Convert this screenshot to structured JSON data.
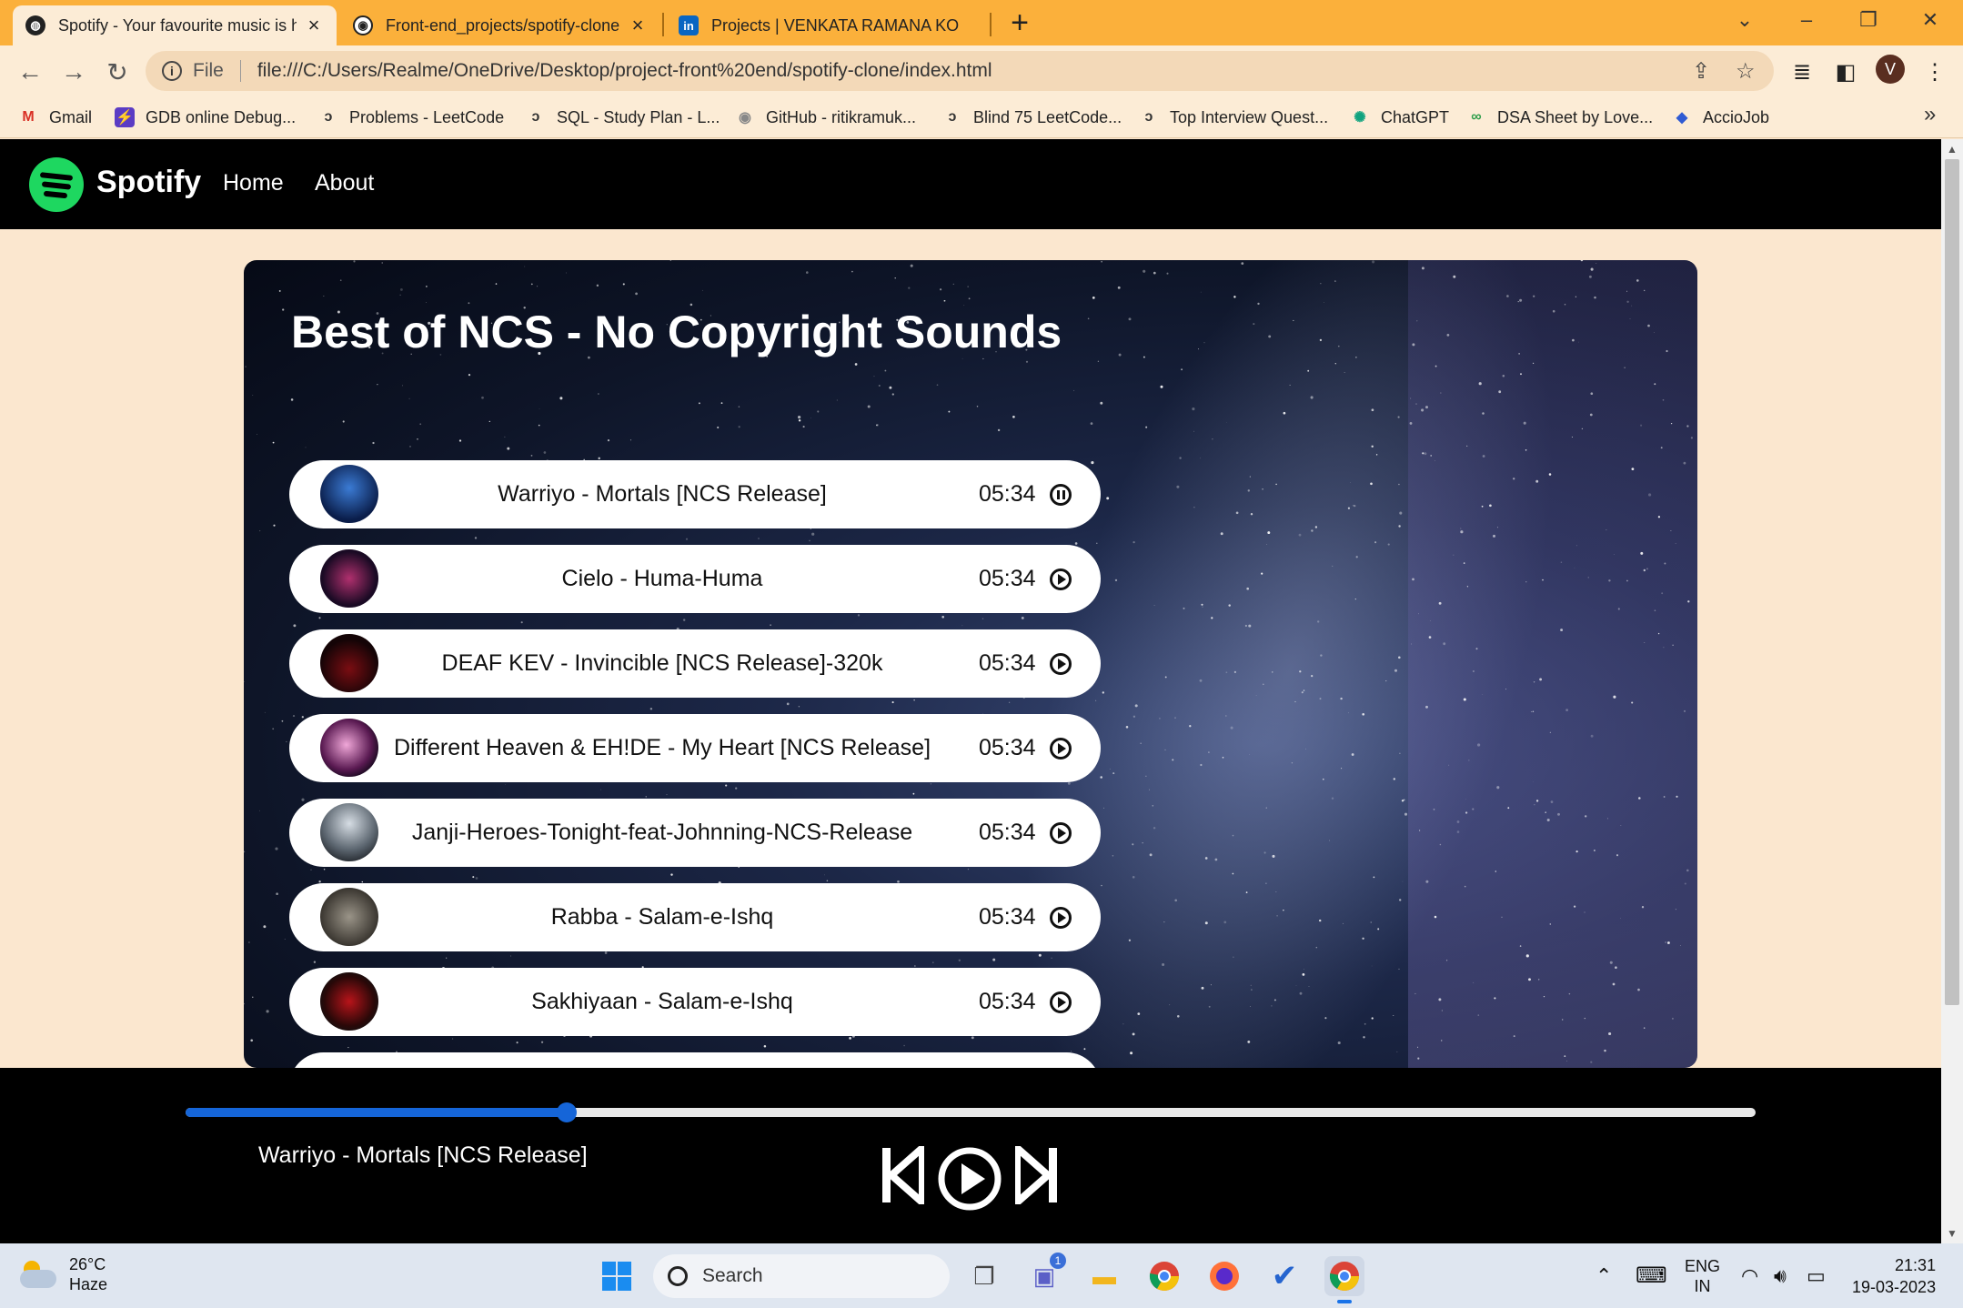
{
  "browser": {
    "tabs": [
      {
        "title": "Spotify - Your favourite music is h",
        "active": true
      },
      {
        "title": "Front-end_projects/spotify-clone",
        "active": false
      },
      {
        "title": "Projects | VENKATA RAMANA KO",
        "active": false
      }
    ],
    "address": {
      "scheme_label": "File",
      "url": "file:///C:/Users/Realme/OneDrive/Desktop/project-front%20end/spotify-clone/index.html"
    },
    "profile_initial": "V",
    "bookmarks": [
      {
        "label": "Gmail",
        "icon": "gmail-icon"
      },
      {
        "label": "GDB online Debug...",
        "icon": "gdb-icon"
      },
      {
        "label": "Problems - LeetCode",
        "icon": "leetcode-icon"
      },
      {
        "label": "SQL - Study Plan - L...",
        "icon": "leetcode-icon"
      },
      {
        "label": "GitHub - ritikramuk...",
        "icon": "github-icon"
      },
      {
        "label": "Blind 75 LeetCode...",
        "icon": "leetcode-icon"
      },
      {
        "label": "Top Interview Quest...",
        "icon": "leetcode-icon"
      },
      {
        "label": "ChatGPT",
        "icon": "chatgpt-icon"
      },
      {
        "label": "DSA Sheet by Love...",
        "icon": "dsa-icon"
      },
      {
        "label": "AccioJob",
        "icon": "acciojob-icon"
      }
    ]
  },
  "page": {
    "brand": "Spotify",
    "nav": [
      "Home",
      "About"
    ],
    "heading": "Best of NCS - No Copyright Sounds",
    "songs": [
      {
        "name": "Warriyo - Mortals [NCS Release]",
        "duration": "05:34",
        "state": "pause"
      },
      {
        "name": "Cielo - Huma-Huma",
        "duration": "05:34",
        "state": "play"
      },
      {
        "name": "DEAF KEV - Invincible [NCS Release]-320k",
        "duration": "05:34",
        "state": "play"
      },
      {
        "name": "Different Heaven & EH!DE - My Heart [NCS Release]",
        "duration": "05:34",
        "state": "play"
      },
      {
        "name": "Janji-Heroes-Tonight-feat-Johnning-NCS-Release",
        "duration": "05:34",
        "state": "play"
      },
      {
        "name": "Rabba - Salam-e-Ishq",
        "duration": "05:34",
        "state": "play"
      },
      {
        "name": "Sakhiyaan - Salam-e-Ishq",
        "duration": "05:34",
        "state": "play"
      }
    ],
    "player": {
      "now_playing": "Warriyo - Mortals [NCS Release]",
      "progress_fraction": 0.243,
      "accent": "#1565d8"
    }
  },
  "taskbar": {
    "weather": {
      "temp": "26°C",
      "condition": "Haze"
    },
    "search_placeholder": "Search",
    "chat_badge": "1",
    "language": "ENG",
    "region": "IN",
    "time": "21:31",
    "date": "19-03-2023"
  }
}
